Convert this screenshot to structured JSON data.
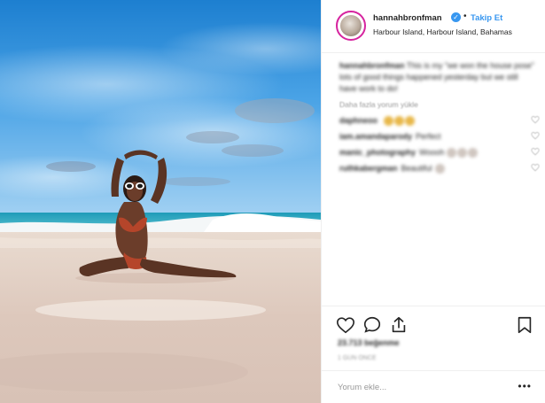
{
  "post": {
    "username": "hannahbronfman",
    "follow_label": "Takip Et",
    "separator": "•",
    "verified_glyph": "✓",
    "location": "Harbour Island, Harbour Island, Bahamas",
    "caption_user": "hannahbronfman",
    "caption_text": "This is my \"we won the house pose\" lots of good things happened yesterday but we still have work to do!",
    "load_more": "Daha fazla yorum yükle",
    "comments": [
      {
        "user": "daphneoo",
        "text": "",
        "emojis": 3,
        "emoji_color": "#e8b84a"
      },
      {
        "user": "iam.amandaparody",
        "text": "Perfect",
        "emojis": 0,
        "emoji_color": "#e8b84a"
      },
      {
        "user": "manic_photography",
        "text": "Woooh",
        "emojis": 3,
        "emoji_color": "#cfc6c0"
      },
      {
        "user": "ruthkabergman",
        "text": "Beautiful",
        "emojis": 1,
        "emoji_color": "#cfc6c0"
      }
    ],
    "likes": "23.713 beğenme",
    "time": "1 GÜN ÖNCE",
    "comment_placeholder": "Yorum ekle...",
    "options_glyph": "•••"
  },
  "icons": [
    "heart-icon",
    "comment-icon",
    "share-icon",
    "bookmark-icon",
    "verified-icon",
    "options-icon"
  ],
  "colors": {
    "accent": "#3897f0",
    "text": "#262626",
    "muted": "#999999",
    "border": "#efefef"
  }
}
